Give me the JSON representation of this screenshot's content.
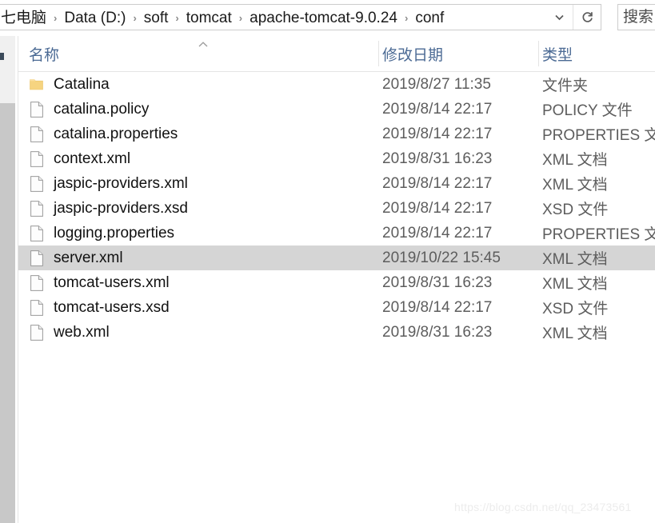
{
  "window": {
    "app": "windows-file-explorer"
  },
  "addressbar": {
    "crumbs": [
      "七电脑",
      "Data (D:)",
      "soft",
      "tomcat",
      "apache-tomcat-9.0.24",
      "conf"
    ],
    "separator": "›",
    "dropdown_icon": "chevron-down-icon",
    "refresh_icon": "refresh-icon",
    "dropdown_glyph": "⌄",
    "refresh_glyph": "↻"
  },
  "search": {
    "placeholder": "",
    "value": "搜索"
  },
  "columns": [
    {
      "label": "名称",
      "key": "name"
    },
    {
      "label": "修改日期",
      "key": "date"
    },
    {
      "label": "类型",
      "key": "type"
    }
  ],
  "sort": {
    "column": "名称",
    "direction": "ascending",
    "glyph": "▲"
  },
  "files": [
    {
      "name": "Catalina",
      "date": "2019/8/27 11:35",
      "type": "文件夹",
      "icon": "folder-icon",
      "selected": false
    },
    {
      "name": "catalina.policy",
      "date": "2019/8/14 22:17",
      "type": "POLICY 文件",
      "icon": "file-icon",
      "selected": false
    },
    {
      "name": "catalina.properties",
      "date": "2019/8/14 22:17",
      "type": "PROPERTIES 文件",
      "icon": "file-icon",
      "selected": false
    },
    {
      "name": "context.xml",
      "date": "2019/8/31 16:23",
      "type": "XML 文档",
      "icon": "file-icon",
      "selected": false
    },
    {
      "name": "jaspic-providers.xml",
      "date": "2019/8/14 22:17",
      "type": "XML 文档",
      "icon": "file-icon",
      "selected": false
    },
    {
      "name": "jaspic-providers.xsd",
      "date": "2019/8/14 22:17",
      "type": "XSD 文件",
      "icon": "file-icon",
      "selected": false
    },
    {
      "name": "logging.properties",
      "date": "2019/8/14 22:17",
      "type": "PROPERTIES 文件",
      "icon": "file-icon",
      "selected": false
    },
    {
      "name": "server.xml",
      "date": "2019/10/22 15:45",
      "type": "XML 文档",
      "icon": "file-icon",
      "selected": true
    },
    {
      "name": "tomcat-users.xml",
      "date": "2019/8/31 16:23",
      "type": "XML 文档",
      "icon": "file-icon",
      "selected": false
    },
    {
      "name": "tomcat-users.xsd",
      "date": "2019/8/14 22:17",
      "type": "XSD 文件",
      "icon": "file-icon",
      "selected": false
    },
    {
      "name": "web.xml",
      "date": "2019/8/31 16:23",
      "type": "XML 文档",
      "icon": "file-icon",
      "selected": false
    }
  ],
  "watermark": {
    "text": "https://blog.csdn.net/qq_23473561"
  },
  "colors": {
    "selection": "#d5d5d5",
    "header_text": "#4b6a94",
    "secondary_text": "#5d5d5d",
    "folder": "#f8d57e",
    "scrollbar_thumb": "#c8c8c8"
  }
}
